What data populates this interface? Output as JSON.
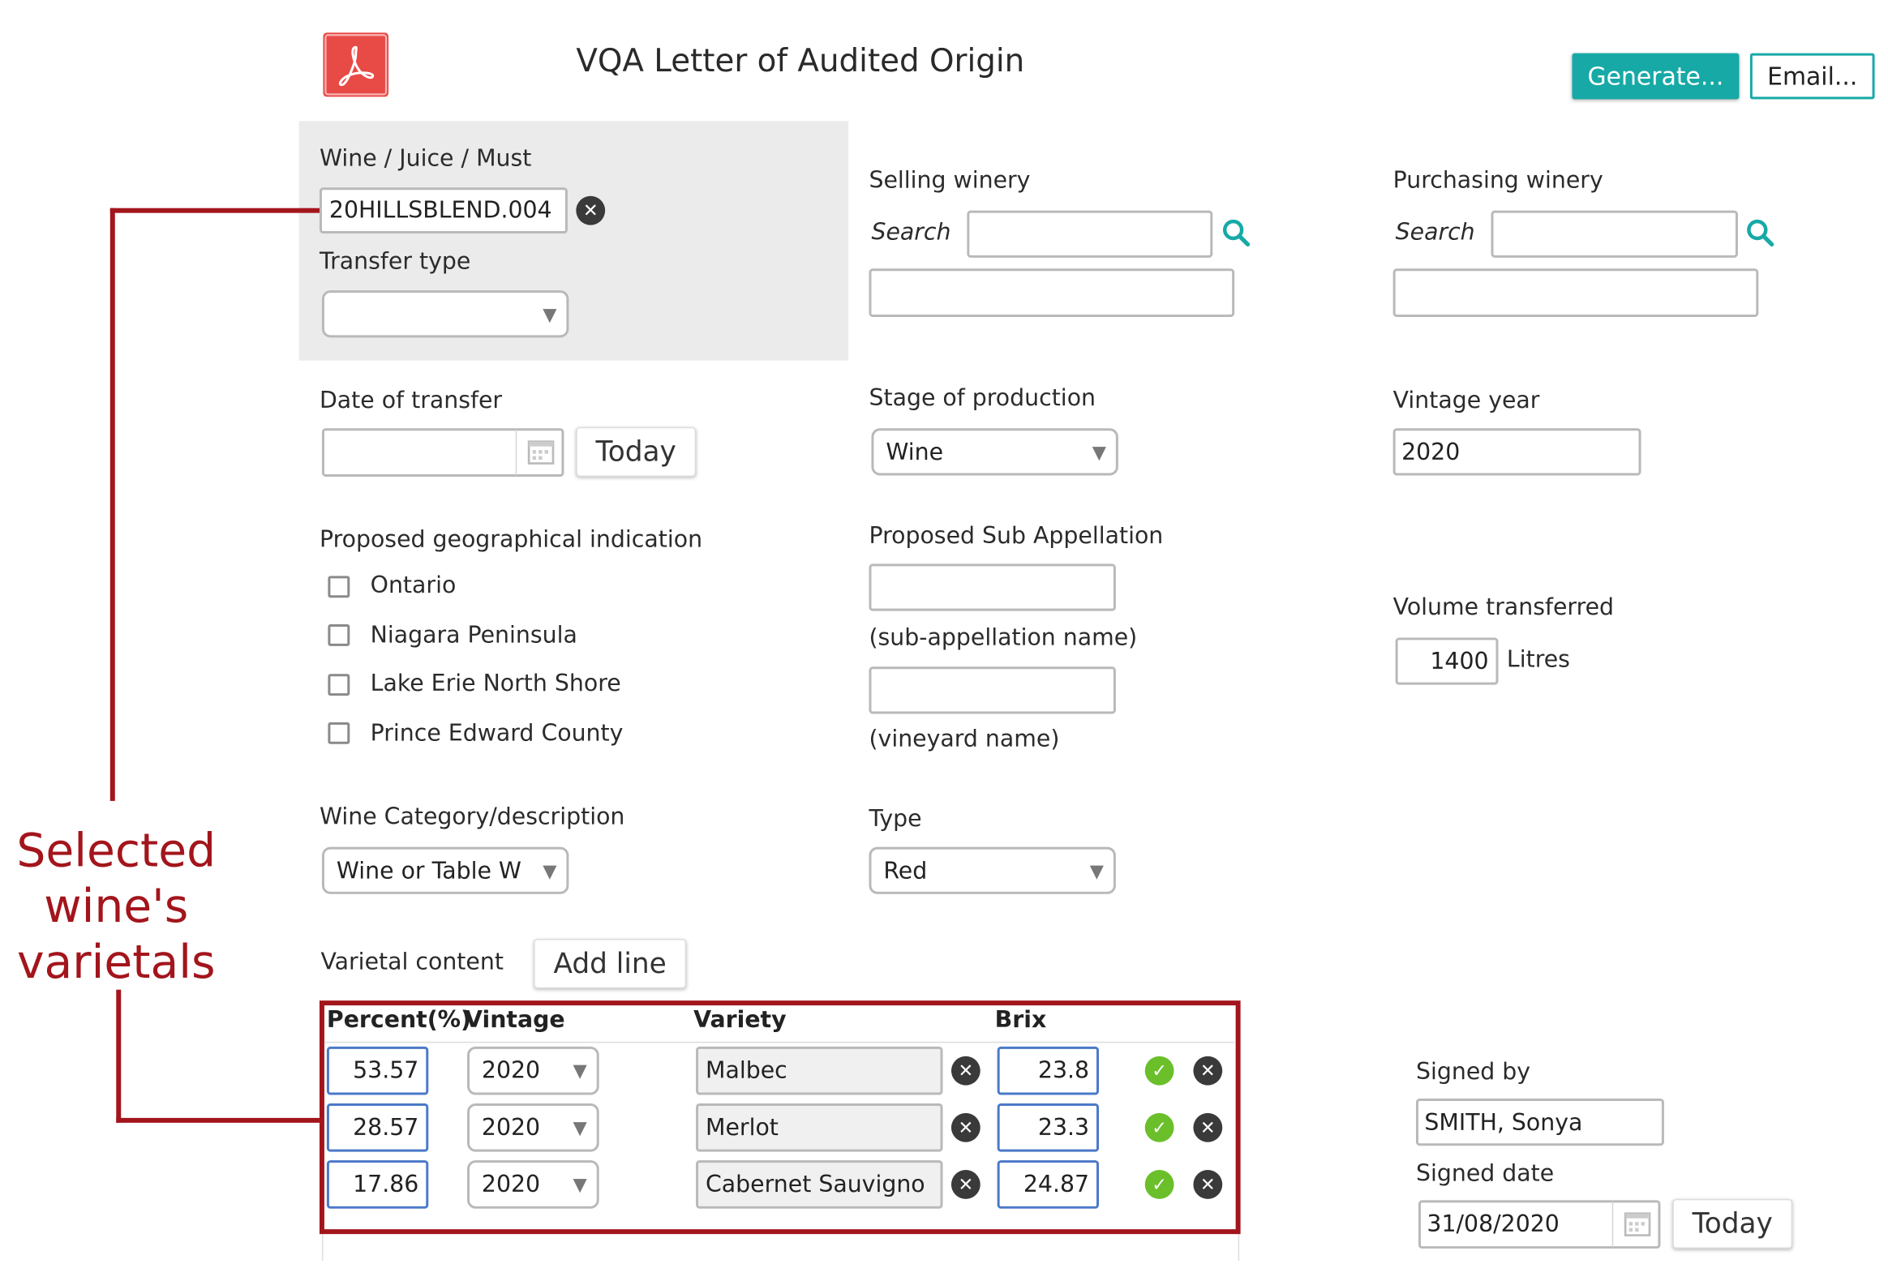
{
  "header": {
    "title": "VQA Letter of Audited Origin",
    "generate_label": "Generate...",
    "email_label": "Email..."
  },
  "colors": {
    "accent": "#17a9a6",
    "annotation": "#a3151c",
    "ok": "#6bbf2a",
    "pdf": "#e84a46"
  },
  "wine_panel": {
    "wine_label": "Wine / Juice / Must",
    "wine_value": "20HILLSBLEND.004",
    "transfer_type_label": "Transfer type",
    "transfer_type_value": ""
  },
  "selling": {
    "label": "Selling winery",
    "search_label": "Search",
    "search_value": "",
    "name_value": ""
  },
  "purchasing": {
    "label": "Purchasing winery",
    "search_label": "Search",
    "search_value": "",
    "name_value": ""
  },
  "date_transfer": {
    "label": "Date of transfer",
    "value": "",
    "today_label": "Today"
  },
  "stage": {
    "label": "Stage of production",
    "value": "Wine"
  },
  "vintage_year": {
    "label": "Vintage year",
    "value": "2020"
  },
  "geo": {
    "label": "Proposed geographical indication",
    "options": [
      "Ontario",
      "Niagara Peninsula",
      "Lake Erie North Shore",
      "Prince Edward County"
    ]
  },
  "sub_app": {
    "label": "Proposed Sub Appellation",
    "sub_value": "",
    "sub_caption": "(sub-appellation name)",
    "vineyard_value": "",
    "vineyard_caption": "(vineyard name)"
  },
  "volume": {
    "label": "Volume transferred",
    "value": "1400",
    "unit": "Litres"
  },
  "category": {
    "label": "Wine Category/description",
    "value": "Wine or Table W"
  },
  "type": {
    "label": "Type",
    "value": "Red"
  },
  "varietal": {
    "label": "Varietal content",
    "add_line_label": "Add line",
    "headers": [
      "Percent(%)",
      "Vintage",
      "Variety",
      "Brix"
    ],
    "rows": [
      {
        "percent": "53.57",
        "vintage": "2020",
        "variety": "Malbec",
        "brix": "23.8"
      },
      {
        "percent": "28.57",
        "vintage": "2020",
        "variety": "Merlot",
        "brix": "23.3"
      },
      {
        "percent": "17.86",
        "vintage": "2020",
        "variety": "Cabernet Sauvigno",
        "brix": "24.87"
      }
    ]
  },
  "signed": {
    "by_label": "Signed by",
    "by_value": "SMITH, Sonya",
    "date_label": "Signed date",
    "date_value": "31/08/2020",
    "today_label": "Today"
  },
  "annotation": {
    "lines": [
      "Selected",
      "wine's",
      "varietals"
    ]
  }
}
